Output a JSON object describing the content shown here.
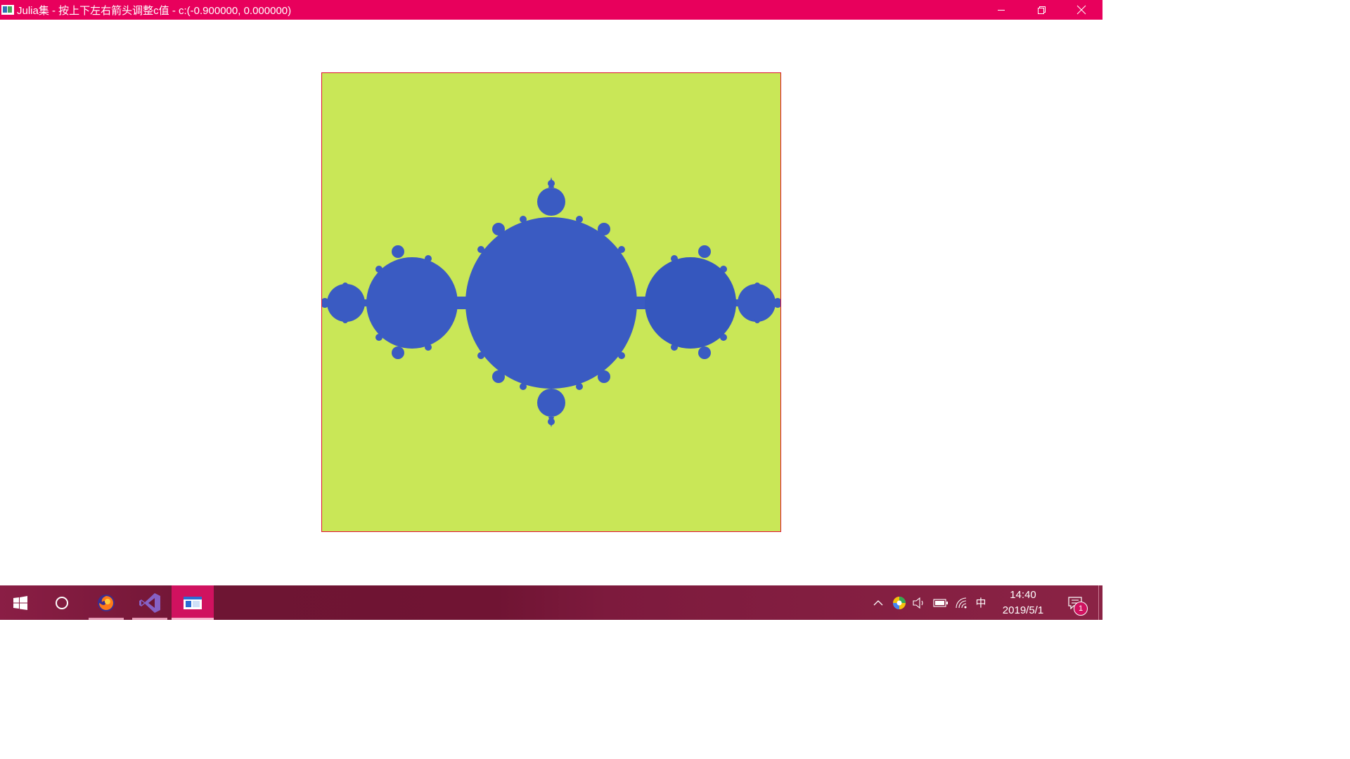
{
  "window": {
    "title": "Julia集 - 按上下左右箭头调整c值 - c:(-0.900000, 0.000000)",
    "controls": [
      "minimize-icon",
      "restore-icon",
      "close-icon"
    ],
    "accent_color": "#e8005c"
  },
  "canvas": {
    "content": "Julia set fractal",
    "c_real": -0.9,
    "c_imag": 0.0,
    "background_color": "#c9e757",
    "fractal_color": "#3a5bc2",
    "border_color": "#e01030"
  },
  "taskbar": {
    "apps": [
      {
        "icon": "windows-start-icon"
      },
      {
        "icon": "cortana-search-icon"
      },
      {
        "icon": "firefox-icon",
        "running": true
      },
      {
        "icon": "visual-studio-icon",
        "running": true
      },
      {
        "icon": "julia-app-window-icon",
        "running": true,
        "active": true
      }
    ],
    "tray": {
      "icons": [
        "chevron-up-icon",
        "app-tray-icon",
        "volume-icon",
        "battery-icon",
        "wifi-icon"
      ],
      "ime_label": "中",
      "time": "14:40",
      "date": "2019/5/1",
      "notification_count": "1"
    }
  }
}
